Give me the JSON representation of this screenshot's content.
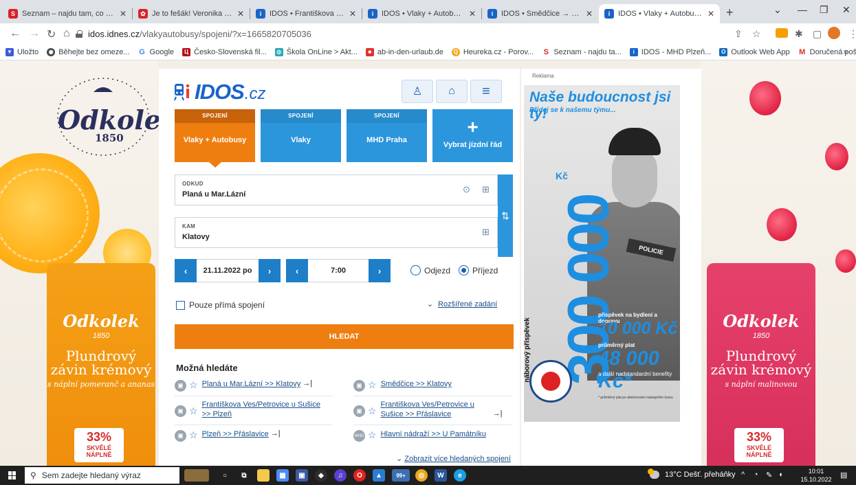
{
  "browser": {
    "tabs": [
      {
        "title": "Seznam – najdu tam, co nezn",
        "icon": "seznam-icon",
        "color": "#d9222a",
        "active": false
      },
      {
        "title": "Je to fešák! Veronika Žílková",
        "icon": "news-icon",
        "color": "#d9222a",
        "active": false
      },
      {
        "title": "IDOS • Františkova Ves/Petrov",
        "icon": "idos-icon",
        "color": "#1a64c8",
        "active": false
      },
      {
        "title": "IDOS • Vlaky + Autobusy • Vy",
        "icon": "idos-icon",
        "color": "#1a64c8",
        "active": false
      },
      {
        "title": "IDOS • Smědčice → Klatovy •",
        "icon": "idos-icon",
        "color": "#1a64c8",
        "active": false
      },
      {
        "title": "IDOS • Vlaky + Autobusy • Vy",
        "icon": "idos-icon",
        "color": "#1a64c8",
        "active": true
      }
    ],
    "url_host": "idos.idnes.cz",
    "url_path": "/vlakyautobusy/spojeni/?x=1665820705036",
    "bookmarks": [
      {
        "label": "Uložto",
        "icon": "ulozto-icon",
        "color": "#3b5bdb"
      },
      {
        "label": "Běhejte bez omeze...",
        "icon": "strava-icon",
        "color": "#444444"
      },
      {
        "label": "Google",
        "icon": "google-icon",
        "color": "#4285f4"
      },
      {
        "label": "Česko-Slovenská fil...",
        "icon": "csfd-icon",
        "color": "#b5121b"
      },
      {
        "label": "Škola OnLine > Akt...",
        "icon": "skola-icon",
        "color": "#27a9b5"
      },
      {
        "label": "ab-in-den-urlaub.de",
        "icon": "urlaub-icon",
        "color": "#e0322f"
      },
      {
        "label": "Heureka.cz - Porov...",
        "icon": "heureka-icon",
        "color": "#f5a623"
      },
      {
        "label": "Seznam - najdu ta...",
        "icon": "seznam-icon",
        "color": "#d9222a"
      },
      {
        "label": "IDOS - MHD Plzeň...",
        "icon": "idos-icon",
        "color": "#1a64c8"
      },
      {
        "label": "Outlook Web App",
        "icon": "outlook-icon",
        "color": "#0f6cbd"
      },
      {
        "label": "Doručená pošta -...",
        "icon": "gmail-icon",
        "color": "#d93025"
      }
    ],
    "bookmarks_more": "»"
  },
  "idos": {
    "logo_text": "IDOS",
    "logo_tld": ".cz",
    "modes": [
      {
        "caption": "SPOJENÍ",
        "label": "Vlaky + Autobusy",
        "active": true
      },
      {
        "caption": "SPOJENÍ",
        "label": "Vlaky",
        "active": false
      },
      {
        "caption": "SPOJENÍ",
        "label": "MHD Praha",
        "active": false
      }
    ],
    "add_mode": {
      "plus": "+",
      "label": "Vybrat jízdní řád"
    },
    "from": {
      "label": "ODKUD",
      "value": "Planá u Mar.Lázní"
    },
    "to": {
      "label": "KAM",
      "value": "Klatovy"
    },
    "date": "21.11.2022 po",
    "time": "7:00",
    "departure_label": "Odjezd",
    "arrival_label": "Příjezd",
    "arrival_selected": true,
    "direct_only_label": "Pouze přímá spojení",
    "advanced_label": "Rozšířené zadání",
    "search_label": "HLEDAT",
    "suggestions_title": "Možná hledáte",
    "suggestions": [
      {
        "text": "Planá u Mar.Lázní >> Klatovy",
        "badge": "bus-train-icon"
      },
      {
        "text": "Smědčice >> Klatovy",
        "badge": "bus-train-icon"
      },
      {
        "text": "Františkova Ves/Petrovice u Sušice >> Plzeň",
        "badge": "bus-train-icon"
      },
      {
        "text": "Františkova Ves/Petrovice u Sušice >> Přáslavice",
        "badge": "bus-train-icon"
      },
      {
        "text": "Plzeň >> Přáslavice",
        "badge": "bus-train-icon"
      },
      {
        "text": "Hlavní nádraží >> U Památníku",
        "badge": "mhd-icon"
      }
    ],
    "more_label": "Zobrazit více hledaných spojení",
    "accent_orange": "#ee7e10",
    "accent_blue": "#2b96dc"
  },
  "ad": {
    "label": "Reklama",
    "headline": "Naše budoucnost jsi ty!",
    "subline": "Přidej se k našemu týmu...",
    "big_amount": "300 000",
    "big_currency": "Kč",
    "bonus_caption": "náborový příspěvek",
    "vest_text": "POLICIE",
    "line1_caption": "příspěvek na bydlení a dopravu",
    "line1_value": "10 000 Kč",
    "line2_caption": "průměrný plat",
    "line2_value": "48 000 Kč*",
    "line3_caption": "a další nadstandardní benefity",
    "footnote": "* průměrný plat po absolvování nástupního kurzu"
  },
  "background": {
    "brand": "Odkolek",
    "year": "1850",
    "left_pack": {
      "name": "Plundrový závin krémový",
      "sub": "s náplní pomeranč a ananas",
      "badge_pct": "33%",
      "badge_text": "SKVĚLÉ NÁPLNĚ"
    },
    "right_pack": {
      "name": "Plundrový závin krémový",
      "sub": "s náplní malinovou",
      "badge_pct": "33%",
      "badge_text": "SKVĚLÉ NÁPLNĚ"
    }
  },
  "taskbar": {
    "search_placeholder": "Sem zadejte hledaný výraz",
    "weather": "13°C Dešť. přeháňky",
    "time": "10:01",
    "date": "15.10.2022",
    "badge_99": "99+"
  }
}
